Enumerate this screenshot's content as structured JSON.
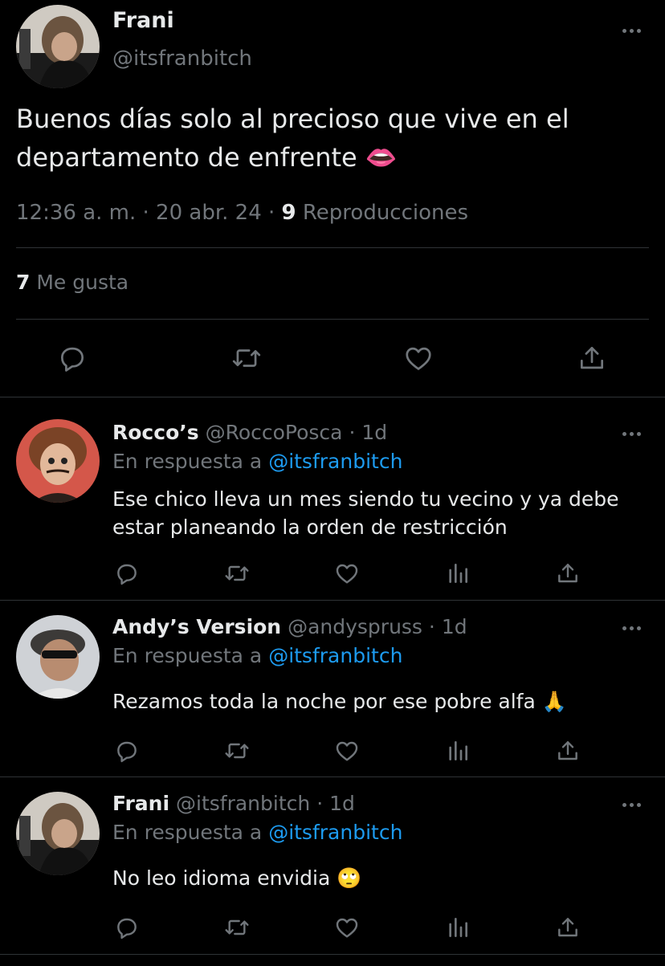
{
  "main_tweet": {
    "author_name": "Frani",
    "author_handle": "@itsfranbitch",
    "text": "Buenos días solo al precioso que vive en el departamento de enfrente 👄",
    "time": "12:36 a. m.",
    "date": "20 abr. 24",
    "views_count": "9",
    "views_label": "Reproducciones",
    "likes_count": "7",
    "likes_label": "Me gusta",
    "sep": "·"
  },
  "reply_prefix": "En respuesta a",
  "replies": [
    {
      "name": "Rocco’s",
      "handle": "@RoccoPosca",
      "time": "1d",
      "reply_to": "@itsfranbitch",
      "text": "Ese chico lleva un mes siendo tu vecino y ya debe estar planeando la orden de restricción"
    },
    {
      "name": "Andy’s Version",
      "handle": "@andyspruss",
      "time": "1d",
      "reply_to": "@itsfranbitch",
      "text": "Rezamos toda la noche por ese pobre alfa 🙏"
    },
    {
      "name": "Frani",
      "handle": "@itsfranbitch",
      "time": "1d",
      "reply_to": "@itsfranbitch",
      "text": "No leo idioma envidia 🙄"
    }
  ],
  "icons": {
    "more": "more-horizontal-icon",
    "reply": "reply-icon",
    "retweet": "retweet-icon",
    "like": "heart-icon",
    "views": "views-icon",
    "share": "share-icon"
  },
  "colors": {
    "background": "#000000",
    "text_primary": "#e7e9ea",
    "text_secondary": "#71767b",
    "link": "#1d9bf0",
    "divider": "#2f3336"
  }
}
